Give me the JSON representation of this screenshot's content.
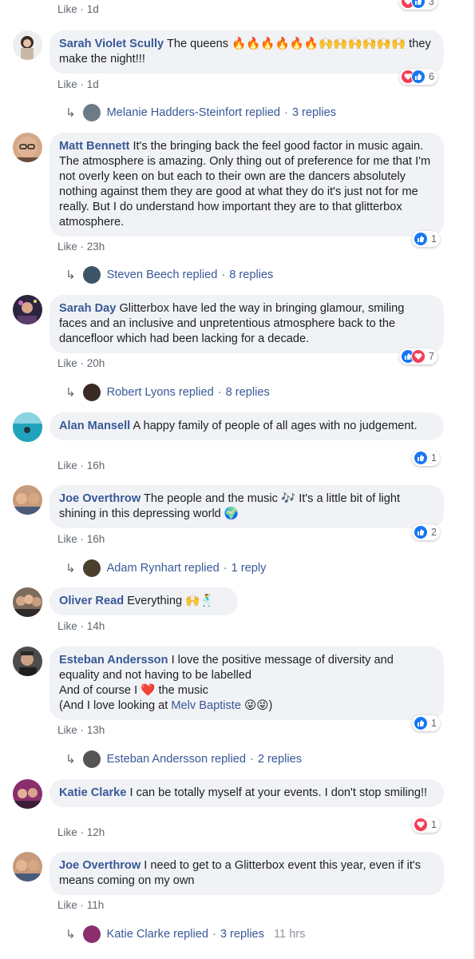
{
  "colors": {
    "link": "#385898",
    "bubble": "#f0f2f5",
    "meta": "#606770",
    "like_icon": "#1877f2",
    "love_icon": "#f33e58"
  },
  "icons": [
    "like-reaction-icon",
    "love-reaction-icon",
    "reply-arrow-icon"
  ],
  "top_meta": {
    "like": "Like",
    "time": "1d",
    "reactions_count": "3"
  },
  "comments": [
    {
      "author": "Sarah Violet Scully",
      "text": "The queens 🔥🔥🔥🔥🔥🔥🙌🙌🙌🙌🙌🙌 they make the night!!!",
      "like": "Like",
      "time": "1d",
      "reactions_count": "6",
      "reply_summary": {
        "name": "Melanie Hadders-Steinfort replied",
        "sep": "·",
        "count": "3 replies"
      }
    },
    {
      "author": "Matt Bennett",
      "text": "It's the bringing back the feel good factor in music again. The atmosphere is amazing. Only thing out of preference for me that I'm not overly keen on but each to their own are the dancers absolutely nothing against them they are good at what they do it's just not for me really. But I do understand how important they are to that glitterbox atmosphere.",
      "like": "Like",
      "time": "23h",
      "reactions_count": "1",
      "reply_summary": {
        "name": "Steven Beech replied",
        "sep": "·",
        "count": "8 replies"
      }
    },
    {
      "author": "Sarah Day",
      "text": "Glitterbox have led the way in bringing glamour, smiling faces and an inclusive and unpretentious atmosphere back to the dancefloor which had been lacking for a decade.",
      "like": "Like",
      "time": "20h",
      "reactions_count": "7",
      "reply_summary": {
        "name": "Robert Lyons replied",
        "sep": "·",
        "count": "8 replies"
      }
    },
    {
      "author": "Alan Mansell",
      "text": "A happy family of people of all ages with no judgement.",
      "like": "Like",
      "time": "16h",
      "reactions_count": "1"
    },
    {
      "author": "Joe Overthrow",
      "text": "The people and the music 🎶 It's a little bit of light shining in this depressing world 🌍",
      "like": "Like",
      "time": "16h",
      "reactions_count": "2",
      "reply_summary": {
        "name": "Adam Rynhart replied",
        "sep": "·",
        "count": "1 reply"
      }
    },
    {
      "author": "Oliver Read",
      "text": "Everything 🙌🕺",
      "like": "Like",
      "time": "14h"
    },
    {
      "author": "Esteban Andersson",
      "text_line1": "I love the positive message of diversity and equality and not having to be labelled",
      "text_line2a": "And of course I",
      "text_heart": "❤️",
      "text_line2b": "the music",
      "text_line3a": "(And I love looking at",
      "mention": "Melv Baptiste",
      "text_line3b": "😜😜)",
      "like": "Like",
      "time": "13h",
      "reactions_count": "1",
      "reply_summary": {
        "name": "Esteban Andersson replied",
        "sep": "·",
        "count": "2 replies"
      }
    },
    {
      "author": "Katie Clarke",
      "text": "I can be totally myself at your events. I don't stop smiling!!",
      "like": "Like",
      "time": "12h",
      "reactions_count": "1"
    },
    {
      "author": "Joe Overthrow",
      "text": "I need to get to a Glitterbox event this year, even if it's means coming on my own",
      "like": "Like",
      "time": "11h",
      "reply_summary": {
        "name": "Katie Clarke replied",
        "sep": "·",
        "count": "3 replies",
        "time": "11 hrs"
      }
    }
  ]
}
